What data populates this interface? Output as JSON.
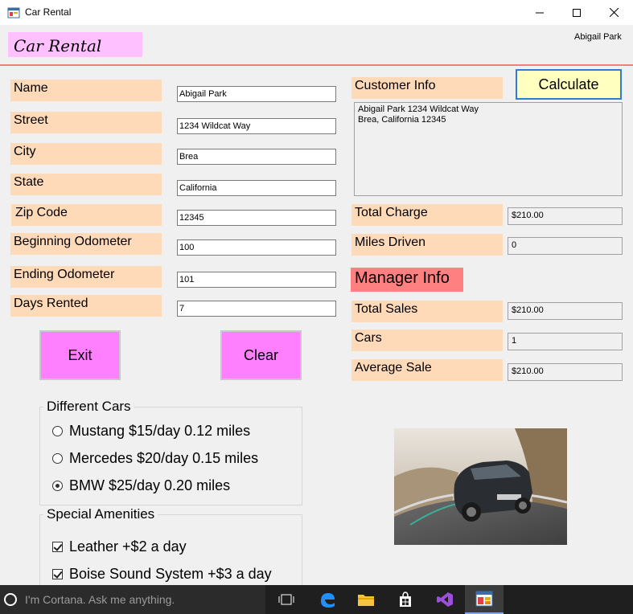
{
  "window": {
    "title": "Car Rental",
    "header": "Car Rental",
    "user": "Abigail Park"
  },
  "fields": [
    {
      "label": "Name",
      "value": "Abigail Park"
    },
    {
      "label": "Street",
      "value": "1234 Wildcat Way"
    },
    {
      "label": "City",
      "value": "Brea"
    },
    {
      "label": "State",
      "value": "California"
    },
    {
      "label": "Zip Code",
      "value": "12345"
    },
    {
      "label": "Beginning Odometer",
      "value": "100"
    },
    {
      "label": "Ending Odometer",
      "value": "101"
    },
    {
      "label": "Days Rented",
      "value": "7"
    }
  ],
  "buttons": {
    "exit": "Exit",
    "clear": "Clear",
    "calculate": "Calculate"
  },
  "customer": {
    "label": "Customer Info",
    "text": "Abigail Park 1234 Wildcat Way\nBrea, California 12345"
  },
  "results": {
    "total_charge": {
      "label": "Total Charge",
      "value": "$210.00"
    },
    "miles_driven": {
      "label": "Miles Driven",
      "value": "0"
    }
  },
  "manager": {
    "label": "Manager Info",
    "total_sales": {
      "label": "Total Sales",
      "value": "$210.00"
    },
    "cars": {
      "label": "Cars",
      "value": "1"
    },
    "average_sale": {
      "label": "Average Sale",
      "value": "$210.00"
    }
  },
  "cars_group": {
    "title": "Different Cars",
    "options": [
      {
        "label": "Mustang $15/day 0.12 miles",
        "selected": false
      },
      {
        "label": "Mercedes $20/day 0.15 miles",
        "selected": false
      },
      {
        "label": "BMW $25/day 0.20 miles",
        "selected": true
      }
    ]
  },
  "amenities_group": {
    "title": "Special Amenities",
    "options": [
      {
        "label": "Leather +$2 a day",
        "checked": true
      },
      {
        "label": "Boise Sound System +$3 a day",
        "checked": true
      }
    ]
  },
  "taskbar": {
    "search_placeholder": "I'm Cortana. Ask me anything."
  },
  "colors": {
    "header_label": "#ffc0ff",
    "field_label": "#ffdab9",
    "button": "#ff80ff",
    "calculate_button": "#ffffc0",
    "manager_label": "#ff8080",
    "header_rule": "#f07f7f"
  }
}
